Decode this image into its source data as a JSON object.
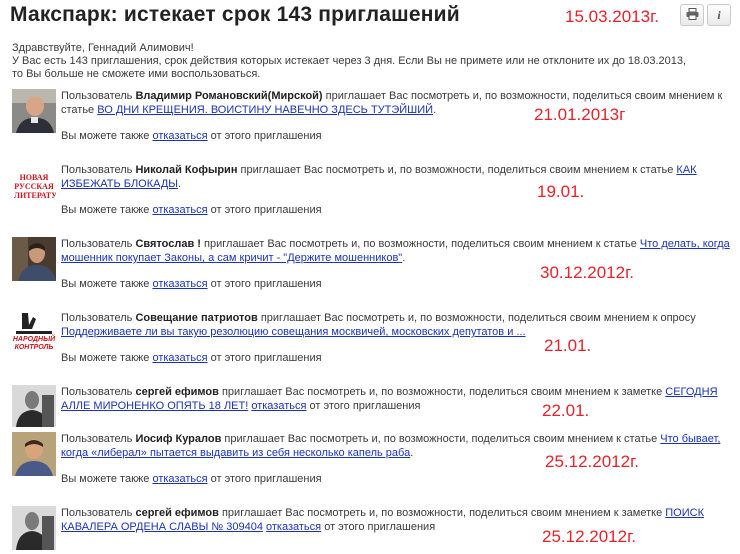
{
  "header": {
    "title": "Макспарк: истекает срок 143 приглашений",
    "date_note": "15.03.2013г.",
    "print_icon": "printer-icon",
    "info_icon": "info-icon"
  },
  "intro": {
    "greeting": "Здравствуйте, Геннадий Алимович!",
    "line1": "У Вас есть 143 приглашения, срок действия которых истекает через 3 дня. Если Вы не примете или не отклоните их до 18.03.2013,",
    "line2": "то Вы больше не сможете ими воспользоваться."
  },
  "common": {
    "user_word": "Пользователь",
    "invite_text_article": "приглашает Вас посмотреть и, по возможности, поделиться своим мнением к статье",
    "invite_text_note": "приглашает Вас посмотреть и, по возможности, поделиться своим мнением к заметке",
    "invite_text_poll": "приглашает Вас посмотреть и, по возможности, поделиться своим мнением к опросу",
    "also_prefix": "Вы можете также",
    "decline_link": "отказаться",
    "also_suffix": "от этого приглашения"
  },
  "invitations": [
    {
      "user": "Владимир Романовский(Мирской)",
      "link": "ВО ДНИ КРЕЩЕНИЯ. ВОИСТИНУ НАВЕЧНО ЗДЕСЬ ТУТЭЙШИЙ",
      "date_note": "21.01.2013г"
    },
    {
      "user": "Николай Кофырин",
      "link": "КАК ИЗБЕЖАТЬ БЛОКАДЫ",
      "date_note": "19.01.",
      "avatar_text": "НОВАЯ РУССКАЯ ЛИТЕРАТУРА"
    },
    {
      "user": "Святослав !",
      "link": "Что делать, когда мошенник покупает Законы, а сам кричит - \"Держите мошенников\"",
      "date_note": "30.12.2012г."
    },
    {
      "user": "Совещание патриотов",
      "link": "Поддерживаете ли вы такую резолюцию совещания москвичей, московских депутатов и ...",
      "date_note": "21.01.",
      "avatar_text": "НАРОДНЫЙ КОНТРОЛЬ"
    },
    {
      "user": "сергей ефимов",
      "link": "СЕГОДНЯ АЛЛЕ МИРОНЕНКО ОПЯТЬ 18 ЛЕТ!",
      "date_note": "22.01."
    },
    {
      "user": "Иосиф Куралов",
      "link": "Что бывает, когда «либерал» пытается выдавить из себя несколько капель раба",
      "date_note": "25.12.2012г."
    },
    {
      "user": "сергей ефимов",
      "link": "ПОИСК КАВАЛЕРА ОРДЕНА СЛАВЫ № 309404",
      "date_note": "25.12.2012г."
    }
  ]
}
